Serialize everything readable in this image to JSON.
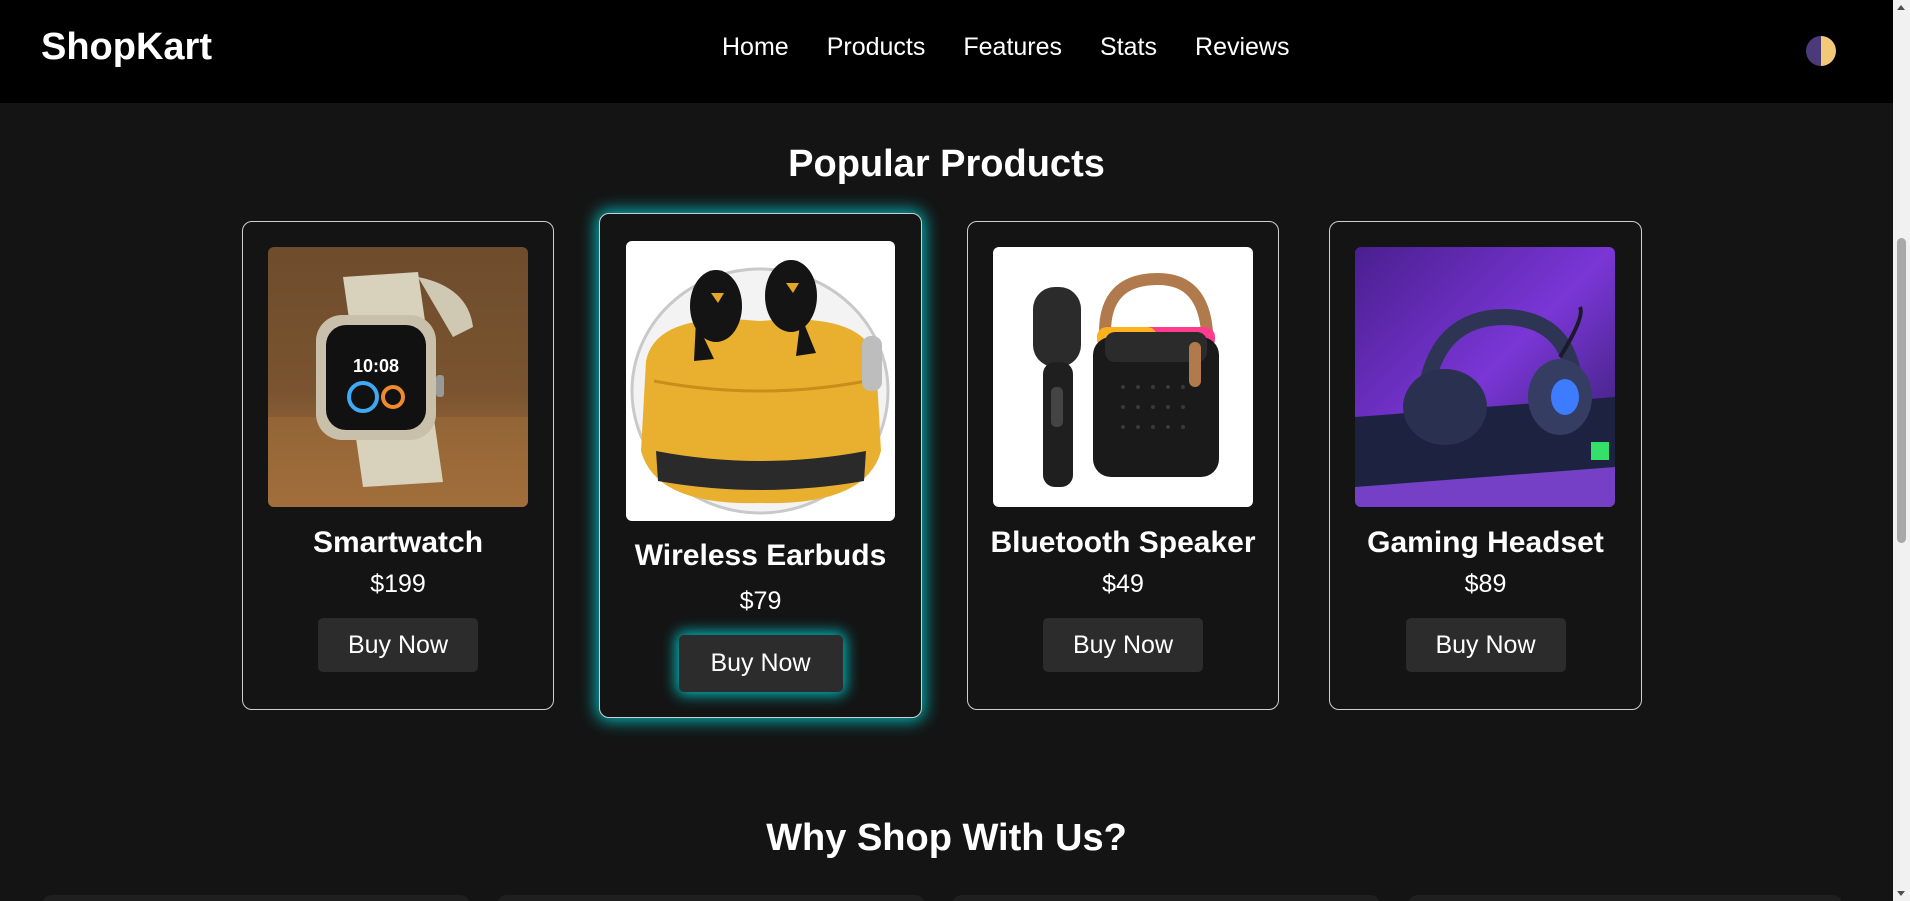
{
  "header": {
    "brand": "ShopKart",
    "nav": [
      "Home",
      "Products",
      "Features",
      "Stats",
      "Reviews"
    ],
    "theme_toggle_icon": "theme-toggle-icon"
  },
  "sections": {
    "popular_title": "Popular Products",
    "why_title": "Why Shop With Us?"
  },
  "products": [
    {
      "name": "Smartwatch",
      "price": "$199",
      "button": "Buy Now",
      "image_icon": "smartwatch-image"
    },
    {
      "name": "Wireless Earbuds",
      "price": "$79",
      "button": "Buy Now",
      "image_icon": "earbuds-image"
    },
    {
      "name": "Bluetooth Speaker",
      "price": "$49",
      "button": "Buy Now",
      "image_icon": "speaker-image"
    },
    {
      "name": "Gaming Headset",
      "price": "$89",
      "button": "Buy Now",
      "image_icon": "headset-image"
    }
  ],
  "colors": {
    "background": "#141414",
    "header": "#000000",
    "highlight_glow": "#00CED1",
    "button": "#2c2c2c"
  }
}
